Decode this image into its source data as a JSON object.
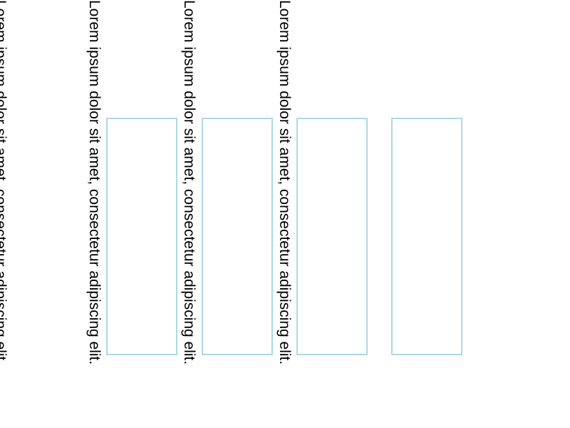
{
  "text_columns": [
    {
      "text": "Lorem ipsum dolor sit amet, consectetur adipiscing elit."
    },
    {
      "text": "Lorem ipsum dolor sit amet, consectetur adipiscing elit."
    },
    {
      "text": "Lorem ipsum dolor sit amet, consectetur adipiscing elit."
    },
    {
      "text": "Lorem ipsum dolor sit amet, consectetur adipiscing elit."
    }
  ],
  "colors": {
    "text": "#000000",
    "box_border": "#add8e6",
    "background": "#ffffff"
  }
}
